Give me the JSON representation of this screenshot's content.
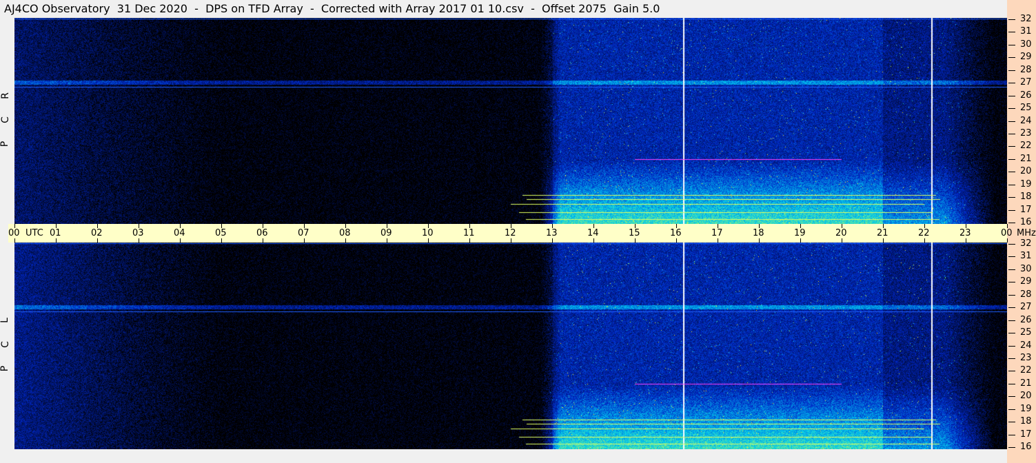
{
  "title": "AJ4CO Observatory  31 Dec 2020  -  DPS on TFD Array  -  Corrected with Array 2017 01 10.csv  -  Offset 2075  Gain 5.0",
  "chart_data": {
    "type": "heatmap",
    "title": "AJ4CO Observatory  31 Dec 2020  -  DPS on TFD Array  -  Corrected with Array 2017 01 10.csv  -  Offset 2075  Gain 5.0",
    "xlabel": "UTC",
    "ylabel": "MHz",
    "x_ticks": [
      "00",
      "01",
      "02",
      "03",
      "04",
      "05",
      "06",
      "07",
      "08",
      "09",
      "10",
      "11",
      "12",
      "13",
      "14",
      "15",
      "16",
      "17",
      "18",
      "19",
      "20",
      "21",
      "22",
      "23",
      "00"
    ],
    "x_range_hours": [
      0,
      24
    ],
    "y_ticks": [
      "16",
      "17",
      "18",
      "19",
      "20",
      "21",
      "22",
      "23",
      "24",
      "25",
      "26",
      "27",
      "28",
      "29",
      "30",
      "31",
      "32"
    ],
    "y_range_mhz": [
      16,
      32
    ],
    "panels": [
      {
        "name": "RCP",
        "label": [
          "R",
          "C",
          "P"
        ]
      },
      {
        "name": "LCP",
        "label": [
          "L",
          "C",
          "P"
        ]
      }
    ],
    "x_unit_label": "UTC",
    "y_unit_label": "MHz",
    "colors": {
      "low": "#000000",
      "mid": "#1040d0",
      "high": "#40e0c0",
      "peak": "#ffff40",
      "marker": "#ffffff"
    }
  }
}
